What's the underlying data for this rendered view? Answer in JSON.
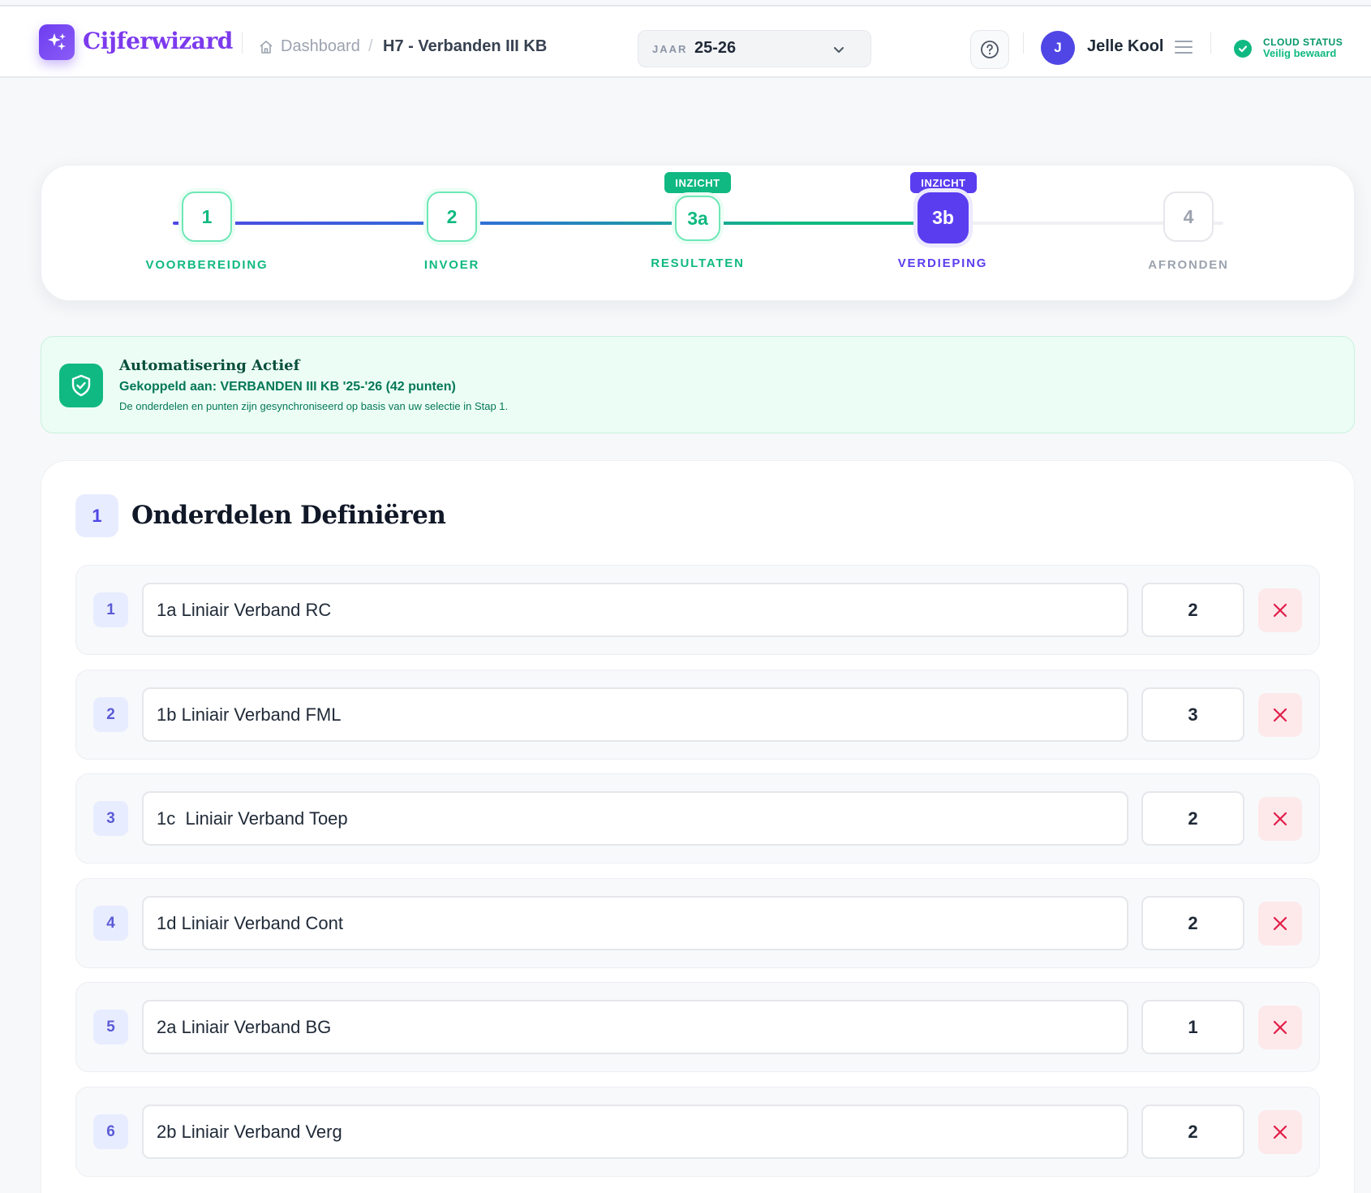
{
  "app": {
    "name": "Cijferwizard"
  },
  "breadcrumb": {
    "home_label": "Dashboard",
    "separator": "/",
    "current": "H7 - Verbanden III KB"
  },
  "year_selector": {
    "label": "JAAR",
    "value": "25-26"
  },
  "user": {
    "initial": "J",
    "name": "Jelle Kool"
  },
  "cloud_status": {
    "title": "CLOUD STATUS",
    "status": "Veilig bewaard"
  },
  "stepper": {
    "steps": [
      {
        "number": "1",
        "label": "VOORBEREIDING",
        "state": "done",
        "badge": ""
      },
      {
        "number": "2",
        "label": "INVOER",
        "state": "done",
        "badge": ""
      },
      {
        "number": "3a",
        "label": "RESULTATEN",
        "state": "done",
        "badge": "INZICHT"
      },
      {
        "number": "3b",
        "label": "VERDIEPING",
        "state": "active",
        "badge": "INZICHT"
      },
      {
        "number": "4",
        "label": "AFRONDEN",
        "state": "todo",
        "badge": ""
      }
    ]
  },
  "alert": {
    "title": "Automatisering Actief",
    "linked": "Gekoppeld aan: VERBANDEN III KB '25-'26 (42 punten)",
    "description": "De onderdelen en punten zijn gesynchroniseerd op basis van uw selectie in Stap 1."
  },
  "section": {
    "number": "1",
    "title": "Onderdelen Definiëren"
  },
  "parts": [
    {
      "index": "1",
      "name": "1a Liniair Verband RC",
      "points": "2"
    },
    {
      "index": "2",
      "name": "1b Liniair Verband FML",
      "points": "3"
    },
    {
      "index": "3",
      "name": "1c  Liniair Verband Toep",
      "points": "2"
    },
    {
      "index": "4",
      "name": "1d Liniair Verband Cont",
      "points": "2"
    },
    {
      "index": "5",
      "name": "2a Liniair Verband BG",
      "points": "1"
    },
    {
      "index": "6",
      "name": "2b Liniair Verband Verg",
      "points": "2"
    }
  ],
  "colors": {
    "brand": "#7c3aed",
    "success": "#10b981",
    "active_step": "#5b3df0",
    "danger": "#e11d48"
  },
  "icons": {
    "logo": "sparkle-wand-icon",
    "home": "home-icon",
    "chevron": "chevron-down-icon",
    "help": "help-circle-icon",
    "menu": "menu-icon",
    "cloud": "check-circle-icon",
    "alert": "shield-check-icon",
    "delete": "close-icon"
  }
}
